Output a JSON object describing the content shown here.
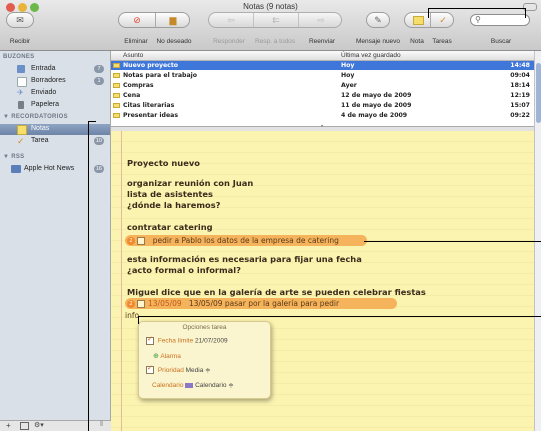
{
  "window": {
    "title": "Notas (9 notas)"
  },
  "toolbar": {
    "receive": "Recibir",
    "delete": "Eliminar",
    "junk": "No deseado",
    "reply": "Responder",
    "reply_all": "Resp. a todos",
    "forward": "Reenviar",
    "new_message": "Mensaje nuevo",
    "note": "Nota",
    "tasks": "Tareas",
    "search": "Buscar",
    "search_placeholder": ""
  },
  "sidebar": {
    "sections": {
      "mailboxes": "BUZONES",
      "reminders": "RECORDATORIOS",
      "rss": "RSS"
    },
    "items": [
      {
        "label": "Entrada",
        "badge": "7"
      },
      {
        "label": "Borradores",
        "badge": "1"
      },
      {
        "label": "Enviado",
        "badge": ""
      },
      {
        "label": "Papelera",
        "badge": ""
      },
      {
        "label": "Notas",
        "badge": ""
      },
      {
        "label": "Tarea",
        "badge": "10"
      },
      {
        "label": "Apple Hot News",
        "badge": "16"
      }
    ]
  },
  "list": {
    "columns": {
      "subject": "Asunto",
      "date": "Última vez guardado"
    },
    "rows": [
      {
        "subject": "Nuevo proyecto",
        "date": "Hoy",
        "time": "14:48"
      },
      {
        "subject": "Notas para el trabajo",
        "date": "Hoy",
        "time": "09:04"
      },
      {
        "subject": "Compras",
        "date": "Ayer",
        "time": "18:14"
      },
      {
        "subject": "Cena",
        "date": "12 de mayo de 2009",
        "time": "12:19"
      },
      {
        "subject": "Citas literarias",
        "date": "11 de mayo de 2009",
        "time": "15:07"
      },
      {
        "subject": "Presentar ideas",
        "date": "4 de mayo de 2009",
        "time": "09:22"
      }
    ]
  },
  "note": {
    "title": "Proyecto nuevo",
    "lines": [
      "organizar reunión con Juan",
      "lista de asistentes",
      "¿dónde la haremos?",
      "contratar catering",
      "esta información es necesaria para fijar una fecha",
      "¿acto formal o informal?",
      "Miguel dice que en la galería de arte se pueden celebrar fiestas"
    ],
    "todo1": "pedir a Pablo los datos de la empresa de catering",
    "todo2_date": "13/05/09",
    "todo2_text": "13/05/09 pasar por la galería para pedir",
    "todo2_cont": "info",
    "badge_num": "2"
  },
  "popover": {
    "title": "Opciones tarea",
    "due_label": "Fecha límite",
    "due_value": "21/07/2009",
    "alarm_label": "Alarma",
    "priority_label": "Prioridad",
    "priority_value": "Media ≑",
    "calendar_label": "Calendario",
    "calendar_value": "Calendario ≑"
  },
  "colors": {
    "selection": "#3f76d9",
    "note_paper": "#fbf3b0",
    "todo_highlight": "#f5b35b",
    "sidebar": "#d9e0e8"
  }
}
